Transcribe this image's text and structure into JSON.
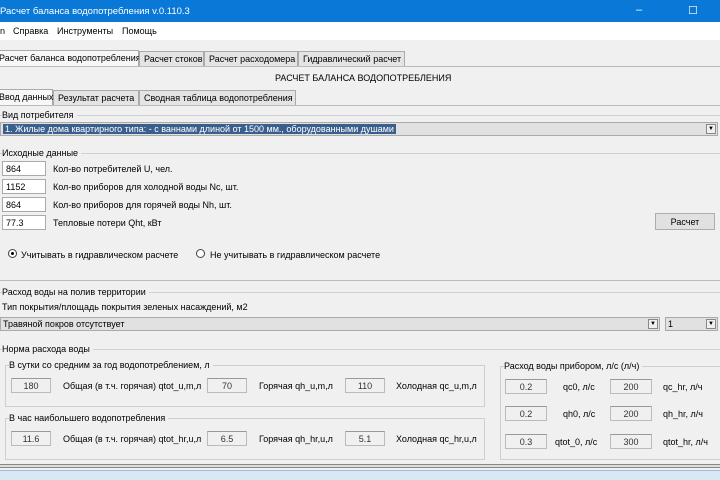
{
  "window": {
    "title": "Расчет баланса водопотребления  v.0.110.3",
    "minimize": "–",
    "maximize": "☐"
  },
  "menu": [
    "n",
    "Справка",
    "Инструменты",
    "Помощь"
  ],
  "tabs": [
    "Расчет баланса водопотребления",
    "Расчет стоков",
    "Расчет расходомера",
    "Гидравлический расчет"
  ],
  "header": "РАСЧЕТ БАЛАНСА ВОДОПОТРЕБЛЕНИЯ",
  "subtabs": [
    "Ввод данных",
    "Результат расчета",
    "Сводная таблица водопотребления"
  ],
  "consumer": {
    "label": "Вид потребителя",
    "value": "1. Жилые дома квартирного типа: - с ваннами длиной от 1500 мм., оборудованными душами"
  },
  "input": {
    "label": "Исходные данные",
    "fields": [
      {
        "value": "864",
        "label": "Кол-во потребителей U, чел."
      },
      {
        "value": "1152",
        "label": "Кол-во приборов для холодной воды Nc, шт."
      },
      {
        "value": "864",
        "label": "Кол-во приборов для горячей воды Nh, шт."
      },
      {
        "value": "77.3",
        "label": "Тепловые потери Qht, кВт"
      }
    ],
    "calc_button": "Расчет",
    "radio_include": "Учитывать в гидравлическом расчете",
    "radio_exclude": "Не учитывать в гидравлическом расчете",
    "selected": "include"
  },
  "watering": {
    "label": "Расход воды на полив территории",
    "sublabel": "Тип покрытия/площадь покрытия зеленых насаждений, м2",
    "value": "Травяной покров отсутствует",
    "count": "1"
  },
  "norm": {
    "label": "Норма расхода воды",
    "daily": {
      "label": "В сутки со средним за год водопотреблением, л",
      "items": [
        {
          "value": "180",
          "label": "Общая (в т.ч. горячая) qtot_u,m,л"
        },
        {
          "value": "70",
          "label": "Горячая qh_u,m,л"
        },
        {
          "value": "110",
          "label": "Холодная qc_u,m,л"
        }
      ]
    },
    "hourly": {
      "label": "В час наибольшего водопотребления",
      "items": [
        {
          "value": "11.6",
          "label": "Общая (в т.ч. горячая) qtot_hr,u,л"
        },
        {
          "value": "6.5",
          "label": "Горячая qh_hr,u,л"
        },
        {
          "value": "5.1",
          "label": "Холодная qc_hr,u,л"
        }
      ]
    }
  },
  "device": {
    "label": "Расход воды прибором, л/с (л/ч)",
    "rows": [
      {
        "v1": "0.2",
        "l1": "qc0, л/с",
        "v2": "200",
        "l2": "qc_hr, л/ч"
      },
      {
        "v1": "0.2",
        "l1": "qh0, л/с",
        "v2": "200",
        "l2": "qh_hr, л/ч"
      },
      {
        "v1": "0.3",
        "l1": "qtot_0,  л/с",
        "v2": "300",
        "l2": "qtot_hr, л/ч"
      }
    ]
  }
}
